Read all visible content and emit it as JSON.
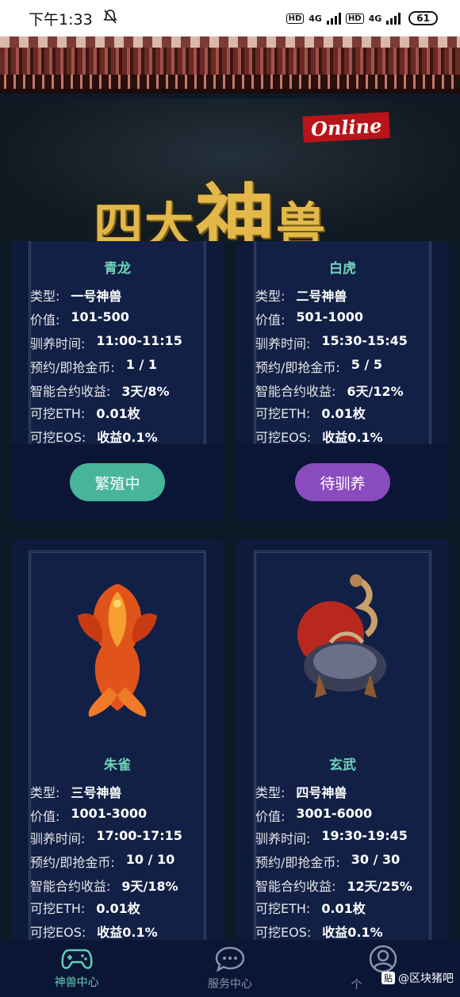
{
  "status_bar": {
    "time": "下午1:33",
    "hd1": "HD",
    "net1": "4G",
    "hd2": "HD",
    "net2": "4G",
    "battery": "61"
  },
  "header": {
    "online_badge": "Online",
    "title_part1": "四大",
    "title_big": "神",
    "title_part2": "兽"
  },
  "labels": {
    "type": "类型:",
    "value": "价值:",
    "time": "驯养时间:",
    "reserve": "预约/即抢金币:",
    "profit": "智能合约收益:",
    "eth": "可挖ETH:",
    "eos": "可挖EOS:"
  },
  "cards": [
    {
      "name": "青龙",
      "type": "一号神兽",
      "value": "101-500",
      "time": "11:00-11:15",
      "reserve": "1 / 1",
      "profit": "3天/8%",
      "eth": "0.01枚",
      "eos": "收益0.1%",
      "button": "繁殖中"
    },
    {
      "name": "白虎",
      "type": "二号神兽",
      "value": "501-1000",
      "time": "15:30-15:45",
      "reserve": "5 / 5",
      "profit": "6天/12%",
      "eth": "0.01枚",
      "eos": "收益0.1%",
      "button": "待驯养"
    },
    {
      "name": "朱雀",
      "type": "三号神兽",
      "value": "1001-3000",
      "time": "17:00-17:15",
      "reserve": "10 / 10",
      "profit": "9天/18%",
      "eth": "0.01枚",
      "eos": "收益0.1%"
    },
    {
      "name": "玄武",
      "type": "四号神兽",
      "value": "3001-6000",
      "time": "19:30-19:45",
      "reserve": "30 / 30",
      "profit": "12天/25%",
      "eth": "0.01枚",
      "eos": "收益0.1%"
    }
  ],
  "nav": {
    "items": [
      {
        "label": "神兽中心",
        "icon": "gamepad-icon"
      },
      {
        "label": "服务中心",
        "icon": "chat-bubble-icon"
      },
      {
        "label": "个",
        "icon": "user-icon"
      }
    ]
  },
  "watermark": {
    "badge": "贴",
    "text": "@区块猪吧"
  },
  "colors": {
    "accent_green": "#47b59c",
    "accent_purple": "#8a4bbf",
    "name_color": "#6fd2b8",
    "title_gold": "#e2b84a"
  }
}
